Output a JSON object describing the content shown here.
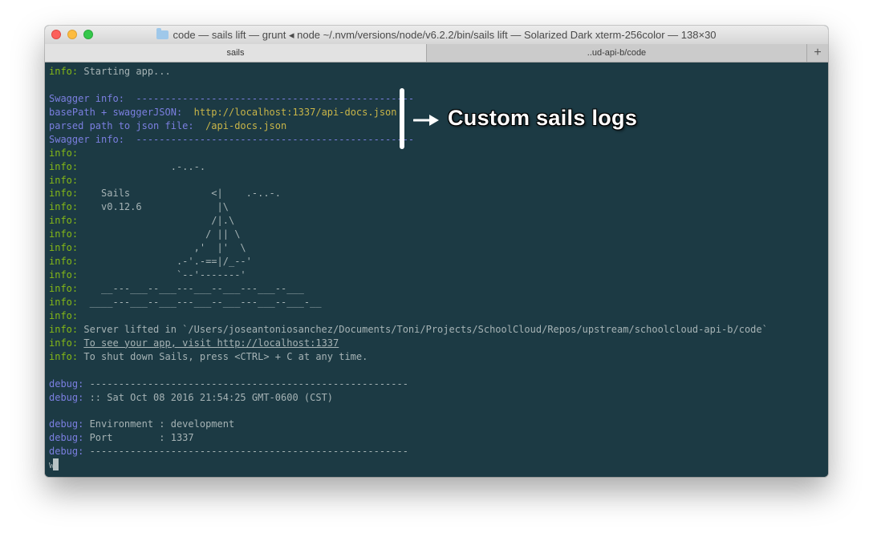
{
  "window": {
    "title": "code — sails lift — grunt ◂ node ~/.nvm/versions/node/v6.2.2/bin/sails lift — Solarized Dark xterm-256color — 138×30",
    "folder_icon": "folder-icon"
  },
  "tabs": [
    {
      "label": "sails",
      "active": true
    },
    {
      "label": "..ud-api-b/code",
      "active": false
    }
  ],
  "tab_add_label": "+",
  "terminal": {
    "lines": [
      [
        {
          "t": "info:",
          "c": "info"
        },
        {
          "t": " Starting app..."
        }
      ],
      [],
      [
        {
          "t": "Swagger info:  ------------------------------------------------",
          "c": "swag"
        }
      ],
      [
        {
          "t": "basePath + swaggerJSON:  ",
          "c": "swag"
        },
        {
          "t": "http://localhost:1337/api-docs.json",
          "c": "yellow"
        }
      ],
      [
        {
          "t": "parsed path to json file:  ",
          "c": "swag"
        },
        {
          "t": "/api-docs.json",
          "c": "yellow"
        }
      ],
      [
        {
          "t": "Swagger info:  ------------------------------------------------",
          "c": "swag"
        }
      ],
      [
        {
          "t": "info:",
          "c": "info"
        }
      ],
      [
        {
          "t": "info:",
          "c": "info"
        },
        {
          "t": "                .-..-."
        }
      ],
      [
        {
          "t": "info:",
          "c": "info"
        }
      ],
      [
        {
          "t": "info:",
          "c": "info"
        },
        {
          "t": "    Sails              <|    .-..-."
        }
      ],
      [
        {
          "t": "info:",
          "c": "info"
        },
        {
          "t": "    v0.12.6             |\\"
        }
      ],
      [
        {
          "t": "info:",
          "c": "info"
        },
        {
          "t": "                       /|.\\"
        }
      ],
      [
        {
          "t": "info:",
          "c": "info"
        },
        {
          "t": "                      / || \\"
        }
      ],
      [
        {
          "t": "info:",
          "c": "info"
        },
        {
          "t": "                    ,'  |'  \\"
        }
      ],
      [
        {
          "t": "info:",
          "c": "info"
        },
        {
          "t": "                 .-'.-==|/_--'"
        }
      ],
      [
        {
          "t": "info:",
          "c": "info"
        },
        {
          "t": "                 `--'-------'"
        }
      ],
      [
        {
          "t": "info:",
          "c": "info"
        },
        {
          "t": "    __---___--___---___--___---___--___"
        }
      ],
      [
        {
          "t": "info:",
          "c": "info"
        },
        {
          "t": "  ____---___--___---___--___---___--___-__"
        }
      ],
      [
        {
          "t": "info:",
          "c": "info"
        }
      ],
      [
        {
          "t": "info:",
          "c": "info"
        },
        {
          "t": " Server lifted in `/Users/joseantoniosanchez/Documents/Toni/Projects/SchoolCloud/Repos/upstream/schoolcloud-api-b/code`"
        }
      ],
      [
        {
          "t": "info:",
          "c": "info"
        },
        {
          "t": " "
        },
        {
          "t": "To see your app, visit http://localhost:1337",
          "c": "ul"
        }
      ],
      [
        {
          "t": "info:",
          "c": "info"
        },
        {
          "t": " To shut down Sails, press <CTRL> + C at any time."
        }
      ],
      [],
      [
        {
          "t": "debug:",
          "c": "dbg"
        },
        {
          "t": " -------------------------------------------------------"
        }
      ],
      [
        {
          "t": "debug:",
          "c": "dbg"
        },
        {
          "t": " :: Sat Oct 08 2016 21:54:25 GMT-0600 (CST)"
        }
      ],
      [],
      [
        {
          "t": "debug:",
          "c": "dbg"
        },
        {
          "t": " Environment : development"
        }
      ],
      [
        {
          "t": "debug:",
          "c": "dbg"
        },
        {
          "t": " Port        : 1337"
        }
      ],
      [
        {
          "t": "debug:",
          "c": "dbg"
        },
        {
          "t": " -------------------------------------------------------"
        }
      ],
      [
        {
          "t": "w"
        },
        {
          "cursor": true
        }
      ]
    ]
  },
  "annotation": {
    "label": "Custom sails logs",
    "arrow_icon": "arrow-right-icon"
  }
}
